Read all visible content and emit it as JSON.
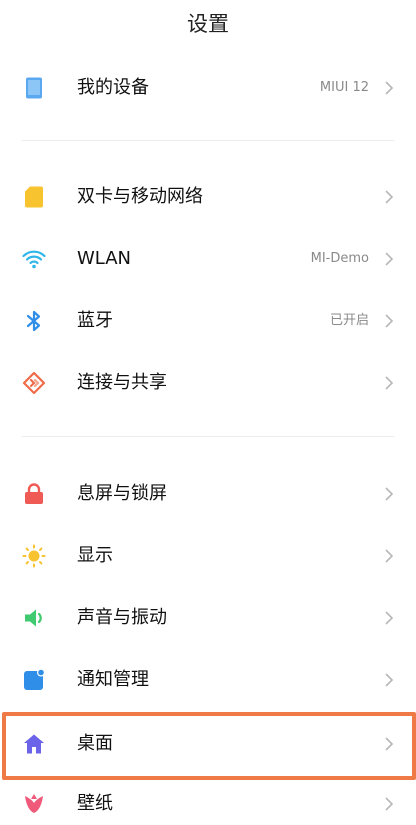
{
  "header": {
    "title": "设置"
  },
  "items": [
    {
      "label": "我的设备",
      "value": "MIUI 12",
      "icon": "device-icon",
      "color": "#5aa8f0"
    },
    {
      "label": "双卡与移动网络",
      "value": "",
      "icon": "sim-card-icon",
      "color": "#f7c32e"
    },
    {
      "label": "WLAN",
      "value": "MI-Demo",
      "icon": "wifi-icon",
      "color": "#2fb5e8"
    },
    {
      "label": "蓝牙",
      "value": "已开启",
      "icon": "bluetooth-icon",
      "color": "#2f8ee8"
    },
    {
      "label": "连接与共享",
      "value": "",
      "icon": "share-icon",
      "color": "#ef6c4a"
    },
    {
      "label": "息屏与锁屏",
      "value": "",
      "icon": "lock-icon",
      "color": "#ef5a55"
    },
    {
      "label": "显示",
      "value": "",
      "icon": "sun-icon",
      "color": "#f7c32e"
    },
    {
      "label": "声音与振动",
      "value": "",
      "icon": "speaker-icon",
      "color": "#3fca6f"
    },
    {
      "label": "通知管理",
      "value": "",
      "icon": "notification-icon",
      "color": "#2f8ee8"
    },
    {
      "label": "桌面",
      "value": "",
      "icon": "home-icon",
      "color": "#6b63e8"
    },
    {
      "label": "壁纸",
      "value": "",
      "icon": "flower-icon",
      "color": "#ef5a7a"
    }
  ],
  "highlight_color": "#f07a45"
}
